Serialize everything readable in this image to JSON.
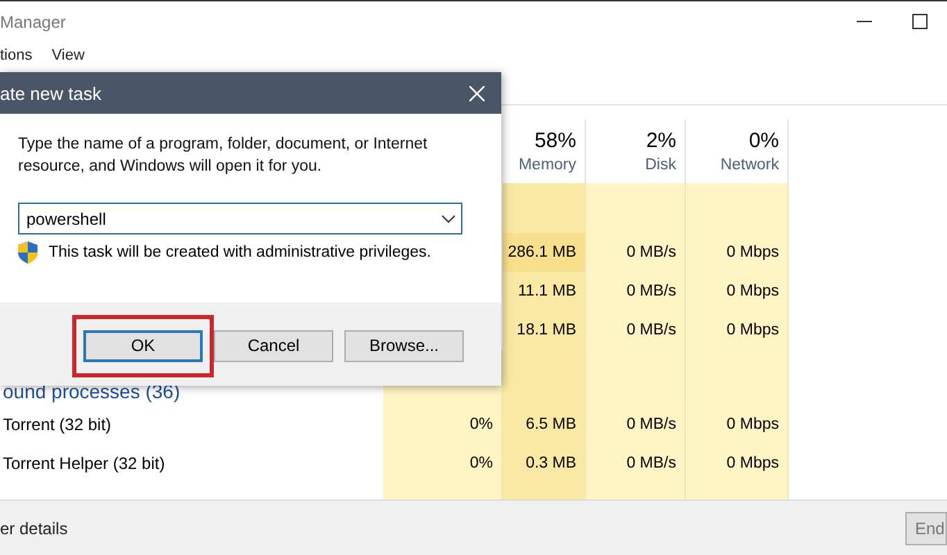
{
  "window": {
    "title": "Manager",
    "menu": [
      "tions",
      "View"
    ]
  },
  "table": {
    "columns": [
      {
        "percent": "58%",
        "label": "Memory"
      },
      {
        "percent": "2%",
        "label": "Disk"
      },
      {
        "percent": "0%",
        "label": "Network"
      }
    ],
    "top_rows": [
      {
        "memory": "286.1 MB",
        "disk": "0 MB/s",
        "network": "0 Mbps"
      },
      {
        "memory": "11.1 MB",
        "disk": "0 MB/s",
        "network": "0 Mbps"
      },
      {
        "memory": "18.1 MB",
        "disk": "0 MB/s",
        "network": "0 Mbps"
      }
    ],
    "group_heading": "ound processes (36)",
    "rows": [
      {
        "name": "Torrent (32 bit)",
        "cpu": "0%",
        "memory": "6.5 MB",
        "disk": "0 MB/s",
        "network": "0 Mbps"
      },
      {
        "name": "Torrent Helper (32 bit)",
        "cpu": "0%",
        "memory": "0.3 MB",
        "disk": "0 MB/s",
        "network": "0 Mbps"
      }
    ]
  },
  "footer": {
    "details_link": "er details",
    "end_button": "End"
  },
  "dialog": {
    "title": "ate new task",
    "message": "Type the name of a program, folder, document, or Internet resource, and Windows will open it for you.",
    "input": {
      "value": "powershell"
    },
    "note": "This task will be created with administrative privileges.",
    "buttons": [
      {
        "label": "OK",
        "focused": true,
        "highlighted": true
      },
      {
        "label": "Cancel",
        "focused": false,
        "highlighted": false
      },
      {
        "label": "Browse...",
        "focused": false,
        "highlighted": false
      }
    ]
  }
}
